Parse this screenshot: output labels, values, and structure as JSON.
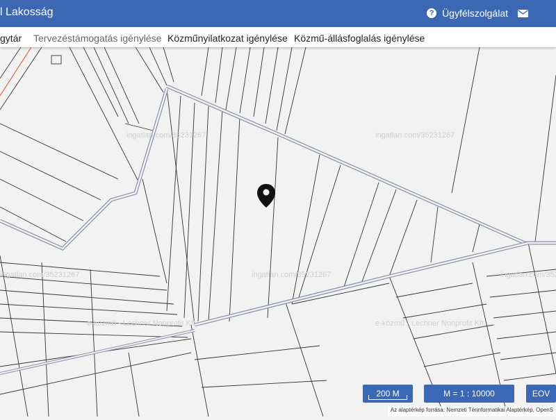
{
  "header": {
    "title": "l Lakosság",
    "support_label": "Ügyfélszolgálat"
  },
  "nav": {
    "items": [
      {
        "label": "gytár",
        "muted": false
      },
      {
        "label": "Tervezéstámogatás igénylése",
        "muted": true
      },
      {
        "label": "Közműnyilatkozat igénylése",
        "muted": false
      },
      {
        "label": "Közmű-állásfoglalás igénylése",
        "muted": false
      }
    ]
  },
  "map": {
    "watermark_site": "ingatlan.com/35231267",
    "watermark_provider": "e-közmű - Lechner Nonprofit Kft.",
    "pin_icon": "map-pin-icon",
    "scale_label": "200 M",
    "ratio_label": "M = 1 : 10000",
    "projection_label": "EOV",
    "attribution": "Az alaptérkép forrása: Nemzeti Térinformatikai Alaptérkép, OpenS"
  },
  "colors": {
    "brand": "#3c68b3",
    "road": "#8a93a8"
  }
}
